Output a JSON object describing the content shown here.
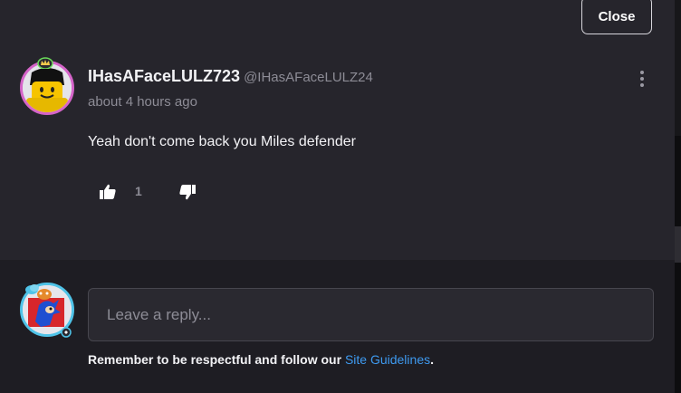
{
  "close_button": {
    "label": "Close"
  },
  "comment": {
    "username": "IHasAFaceLULZ723",
    "handle": "@IHasAFaceLULZ24",
    "timestamp": "about 4 hours ago",
    "body": "Yeah don't come back you Miles defender",
    "upvotes": "1",
    "avatar_border_color": "#d564c9"
  },
  "reply": {
    "placeholder": "Leave a reply...",
    "avatar_border_color": "#4fc3e8",
    "guidelines_prefix": "Remember to be respectful and follow our ",
    "guidelines_link": "Site Guidelines",
    "guidelines_suffix": "."
  },
  "icons": {
    "more": "vertical-ellipsis-icon",
    "upvote": "thumbs-up-icon",
    "downvote": "thumbs-down-icon"
  },
  "colors": {
    "link": "#3e9af0",
    "panel_bg": "#26252c",
    "reply_bg": "#1e1d23"
  }
}
